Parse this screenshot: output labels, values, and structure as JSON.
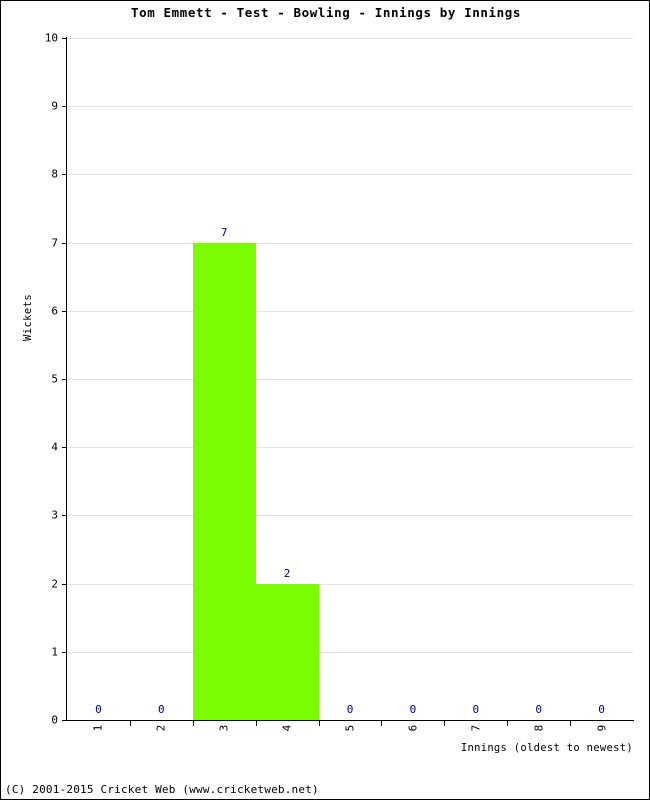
{
  "chart_data": {
    "type": "bar",
    "title": "Tom Emmett - Test - Bowling - Innings by Innings",
    "xlabel": "Innings (oldest to newest)",
    "ylabel": "Wickets",
    "categories": [
      "1",
      "2",
      "3",
      "4",
      "5",
      "6",
      "7",
      "8",
      "9"
    ],
    "values": [
      0,
      0,
      7,
      2,
      0,
      0,
      0,
      0,
      0
    ],
    "value_labels": [
      "0",
      "0",
      "7",
      "2",
      "0",
      "0",
      "0",
      "0",
      "0"
    ],
    "ylim": [
      0,
      10
    ],
    "yticks": [
      "0",
      "1",
      "2",
      "3",
      "4",
      "5",
      "6",
      "7",
      "8",
      "9",
      "10"
    ],
    "grid": true,
    "legend": "none",
    "bar_color": "#7cfc00",
    "value_label_color": "#000080",
    "gridline_color": "#e3e3e3",
    "axis_color": "#000000"
  },
  "footer": {
    "copyright": "(C) 2001-2015 Cricket Web (www.cricketweb.net)"
  }
}
